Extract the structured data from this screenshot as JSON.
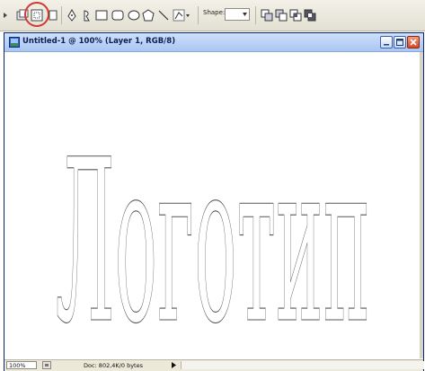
{
  "toolbar": {
    "tools": [
      "shape-layers",
      "paths",
      "fill-pixels",
      "pen",
      "freeform-pen",
      "rectangle",
      "rounded-rectangle",
      "ellipse",
      "polygon",
      "line",
      "custom-shape"
    ],
    "shape_label": "Shape:",
    "shape_value": "",
    "highlight_color": "#d23a33"
  },
  "document": {
    "title": "Untitled-1 @ 100% (Layer 1, RGB/8)",
    "logo_text": "Логотип"
  },
  "statusbar": {
    "zoom": "100%",
    "doc_info": "Doc: 802,4K/0 bytes"
  }
}
